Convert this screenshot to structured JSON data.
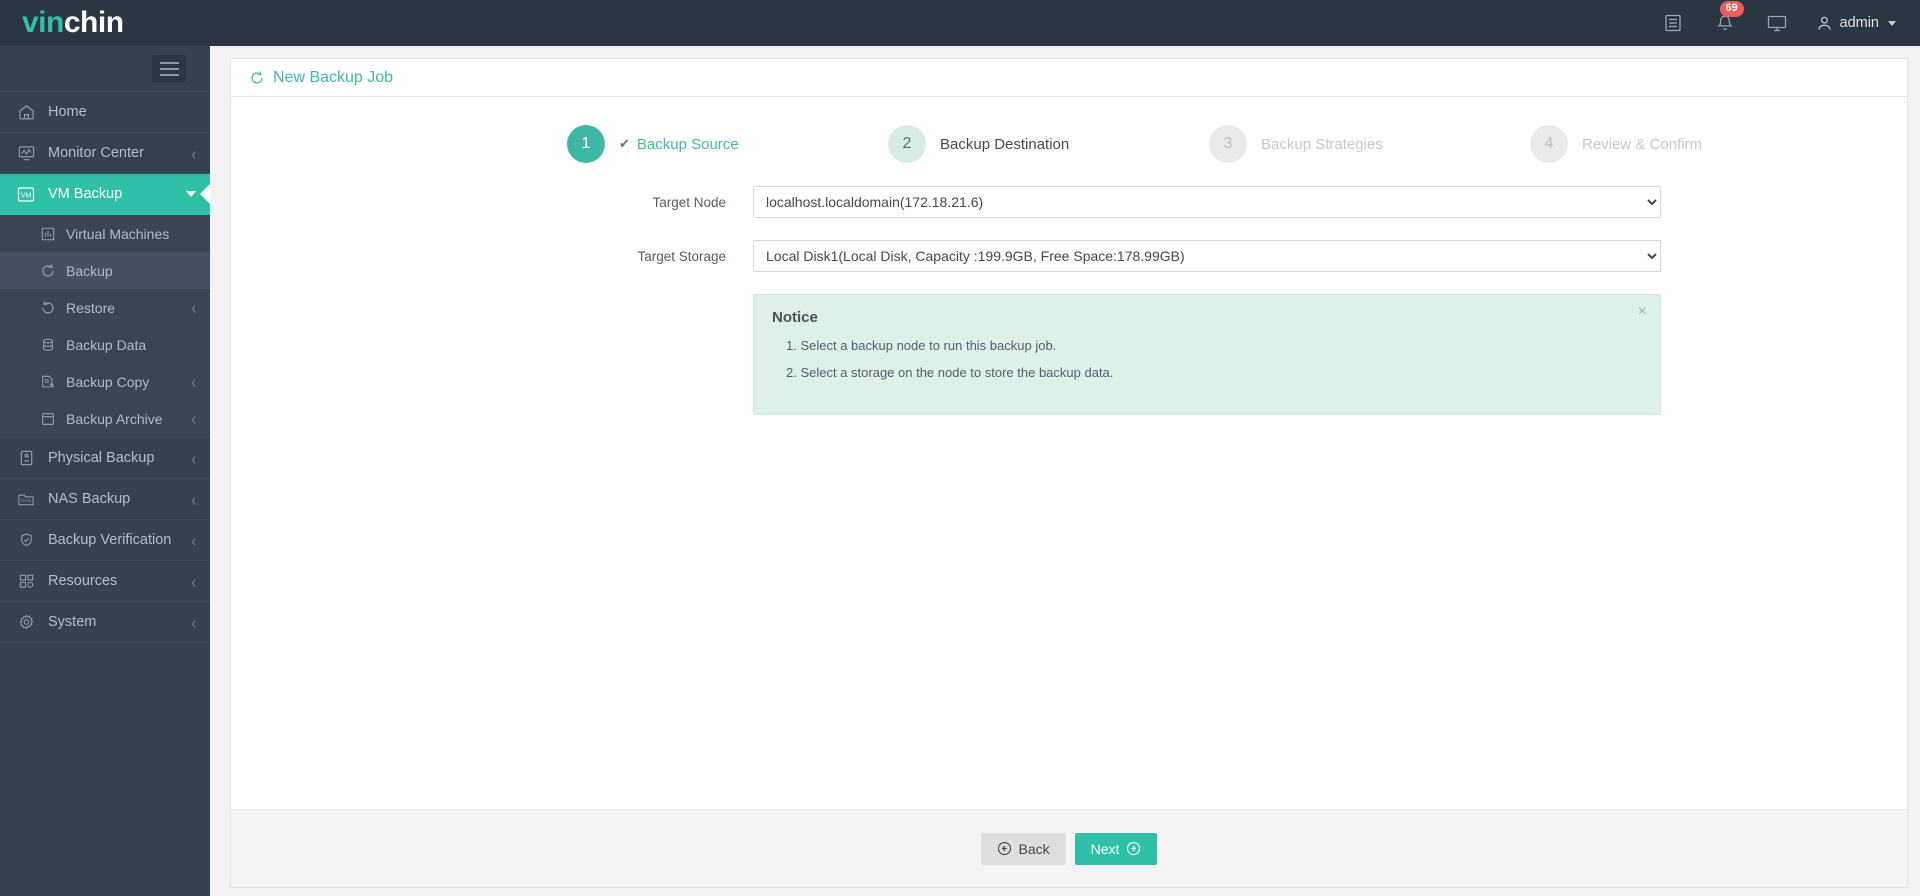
{
  "brand": {
    "part1": "vin",
    "part2": "chin"
  },
  "colors": {
    "teal": "#2fc0a8",
    "teal_dark": "#3eb8a4",
    "sidebar": "#364150",
    "topbar": "#2b3643",
    "badge_red": "#ef5a5a",
    "notice_bg": "#ddf0ea"
  },
  "topbar": {
    "log_icon": "list-icon",
    "bell_icon": "bell-icon",
    "notification_count": "69",
    "screen_icon": "monitor-icon",
    "user_icon": "user-icon",
    "user_label": "admin"
  },
  "sidebar": {
    "toggle_label": "menu-toggle",
    "items": [
      {
        "label": "Home",
        "icon": "home-icon",
        "has_chevron": false,
        "active": false
      },
      {
        "label": "Monitor Center",
        "icon": "monitor-chart-icon",
        "has_chevron": true,
        "active": false
      },
      {
        "label": "VM Backup",
        "icon": "vm-icon",
        "has_chevron": true,
        "active": true
      },
      {
        "label": "Physical Backup",
        "icon": "server-icon",
        "has_chevron": true,
        "active": false
      },
      {
        "label": "NAS Backup",
        "icon": "nas-icon",
        "has_chevron": true,
        "active": false
      },
      {
        "label": "Backup Verification",
        "icon": "shield-check-icon",
        "has_chevron": true,
        "active": false
      },
      {
        "label": "Resources",
        "icon": "grid-icon",
        "has_chevron": true,
        "active": false
      },
      {
        "label": "System",
        "icon": "gear-icon",
        "has_chevron": true,
        "active": false
      }
    ],
    "subitems": [
      {
        "label": "Virtual Machines",
        "icon": "chart-box-icon",
        "has_chevron": false,
        "current": false
      },
      {
        "label": "Backup",
        "icon": "refresh-cw-icon",
        "has_chevron": false,
        "current": true
      },
      {
        "label": "Restore",
        "icon": "refresh-ccw-icon",
        "has_chevron": true,
        "current": false
      },
      {
        "label": "Backup Data",
        "icon": "database-icon",
        "has_chevron": false,
        "current": false
      },
      {
        "label": "Backup Copy",
        "icon": "copy-icon",
        "has_chevron": true,
        "current": false
      },
      {
        "label": "Backup Archive",
        "icon": "archive-icon",
        "has_chevron": true,
        "current": false
      }
    ]
  },
  "panel": {
    "icon": "refresh-cw-icon",
    "title": "New Backup Job"
  },
  "stepper": [
    {
      "number": "1",
      "label": "Backup Source",
      "state": "done",
      "check": "✔"
    },
    {
      "number": "2",
      "label": "Backup Destination",
      "state": "next"
    },
    {
      "number": "3",
      "label": "Backup Strategies",
      "state": "idle"
    },
    {
      "number": "4",
      "label": "Review & Confirm",
      "state": "idle"
    }
  ],
  "form": {
    "target_node": {
      "label": "Target Node",
      "value": "localhost.localdomain(172.18.21.6)",
      "options": [
        "localhost.localdomain(172.18.21.6)"
      ]
    },
    "target_storage": {
      "label": "Target Storage",
      "value": "Local Disk1(Local Disk, Capacity :199.9GB, Free Space:178.99GB)",
      "options": [
        "Local Disk1(Local Disk, Capacity :199.9GB, Free Space:178.99GB)"
      ]
    }
  },
  "notice": {
    "title": "Notice",
    "close_icon": "close-icon",
    "items": [
      "1. Select a backup node to run this backup job.",
      "2. Select a storage on the node to store the backup data."
    ]
  },
  "footer": {
    "back_label": "Back",
    "back_icon": "arrow-left-circle-icon",
    "next_label": "Next",
    "next_icon": "arrow-right-circle-icon"
  }
}
